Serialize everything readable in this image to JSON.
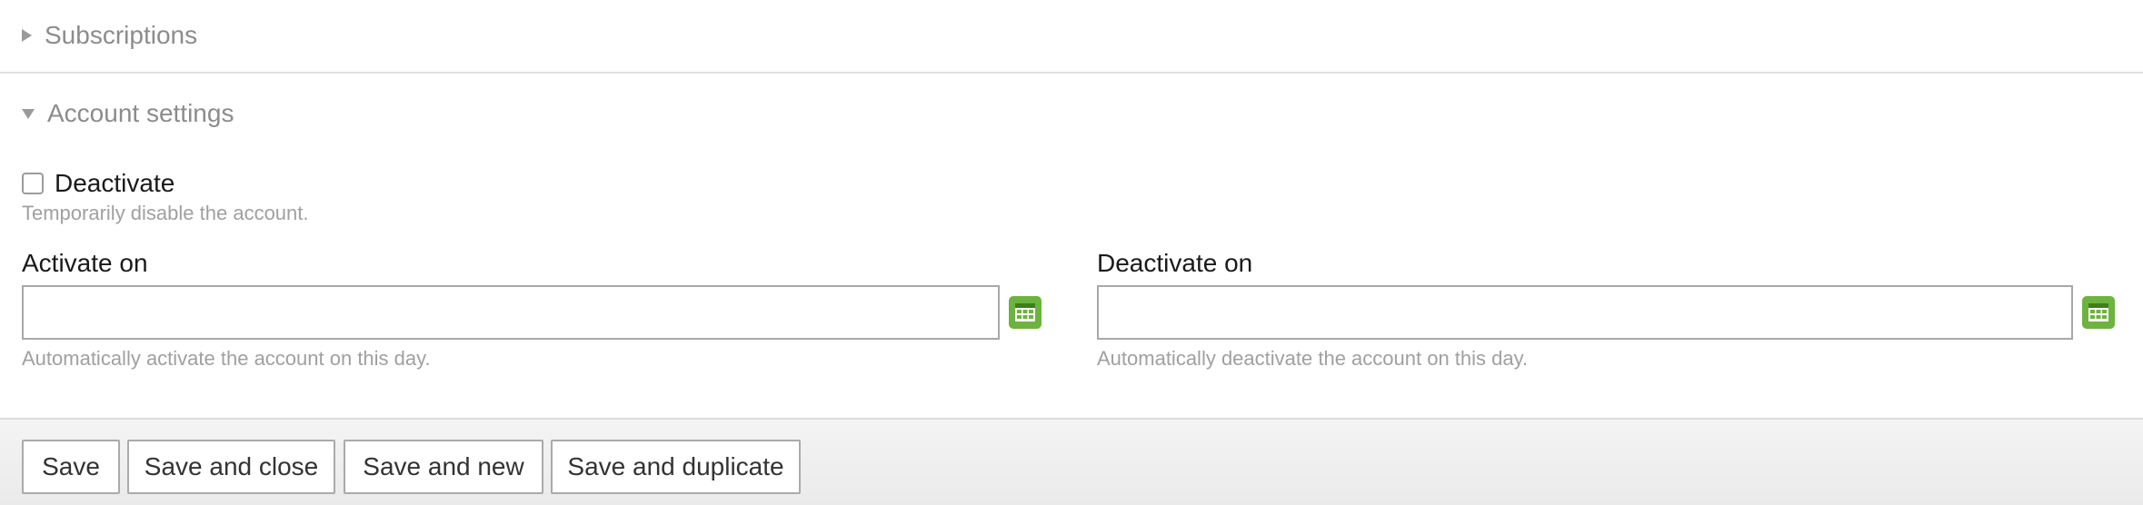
{
  "sections": {
    "subscriptions": {
      "title": "Subscriptions",
      "expanded": false
    },
    "account_settings": {
      "title": "Account settings",
      "expanded": true
    }
  },
  "deactivate": {
    "label": "Deactivate",
    "checked": false,
    "help": "Temporarily disable the account."
  },
  "activate_on": {
    "label": "Activate on",
    "value": "",
    "help": "Automatically activate the account on this day."
  },
  "deactivate_on": {
    "label": "Deactivate on",
    "value": "",
    "help": "Automatically deactivate the account on this day."
  },
  "footer": {
    "save_label": "Save",
    "save_close_label": "Save and close",
    "save_new_label": "Save and new",
    "save_duplicate_label": "Save and duplicate"
  },
  "colors": {
    "calendar_button": "#6db33f",
    "muted_text": "#a0a0a0"
  },
  "icons": {
    "expand": "triangle-right-icon",
    "collapse": "triangle-down-icon",
    "calendar": "calendar-icon"
  }
}
